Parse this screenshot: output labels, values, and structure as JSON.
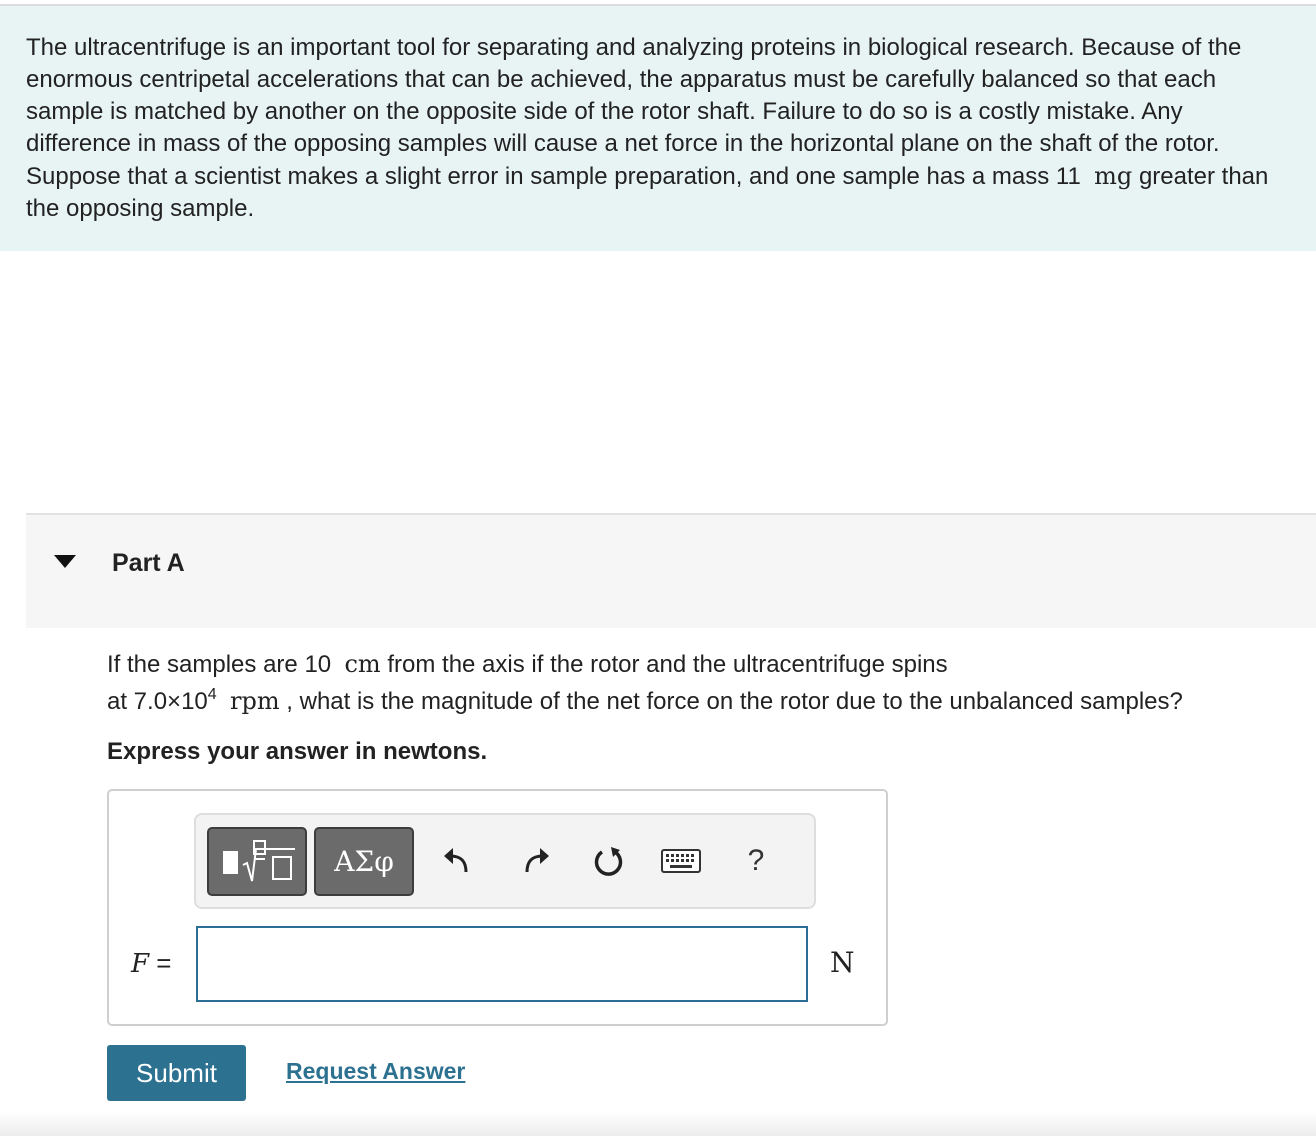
{
  "intro": {
    "text_before": "The ultracentrifuge is an important tool for separating and analyzing proteins in biological research. Because of the enormous centripetal accelerations that can be achieved, the apparatus must be carefully balanced so that each sample is matched by another on the opposite side of the rotor shaft. Failure to do so is a costly mistake. Any difference in mass of the opposing samples will cause a net force in the horizontal plane on the shaft of the rotor. Suppose that a scientist makes a slight error in sample preparation, and one sample has a mass ",
    "mass_value": "11",
    "mass_unit": "mg",
    "text_after": " greater than the opposing sample."
  },
  "part": {
    "title": "Part A",
    "caret_icon": "caret-down-icon"
  },
  "question": {
    "t1": "If the samples are ",
    "dist_value": "10",
    "dist_unit": "cm",
    "t2": " from the axis if the rotor and the ultracentrifuge spins",
    "t3": "at 7.0×10",
    "exp": "4",
    "speed_unit": "rpm",
    "t4": " , what is the magnitude of the net force on the rotor due to the unbalanced samples?"
  },
  "instruction": "Express your answer in newtons.",
  "toolbar": {
    "greek_label": "ΑΣφ",
    "help_label": "?",
    "icons": [
      "templates-icon",
      "undo-icon",
      "redo-icon",
      "reset-icon",
      "keyboard-icon"
    ]
  },
  "answer": {
    "variable": "F",
    "equals": " =",
    "value": "",
    "placeholder": "",
    "unit": "N"
  },
  "actions": {
    "submit_label": "Submit",
    "request_label": "Request Answer"
  },
  "colors": {
    "intro_bg": "#e8f4f4",
    "accent": "#2d7191",
    "toolbar_button": "#6b6b6b"
  }
}
